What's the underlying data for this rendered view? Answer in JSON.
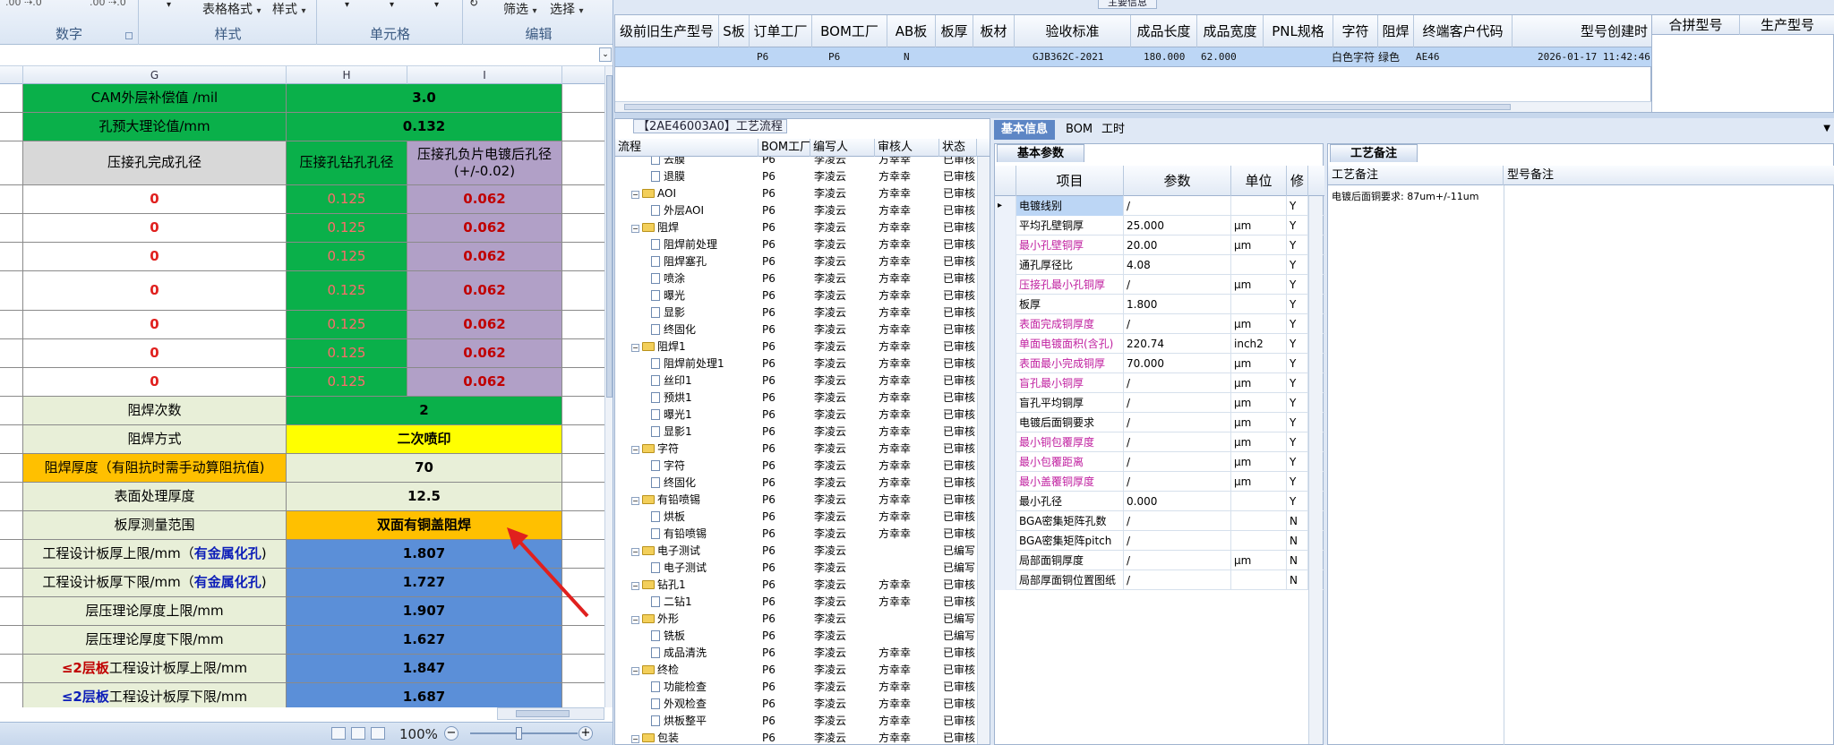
{
  "excel": {
    "ribbon": {
      "number_group": "数字",
      "styles_group": "样式",
      "cells_group": "单元格",
      "editing_group": "编辑",
      "table_format": "表格格式",
      "style": "样式",
      "filter": "筛选",
      "select": "选择"
    },
    "columns": [
      "G",
      "H",
      "I"
    ],
    "rows": [
      {
        "g": "CAM外层补偿值 /mil",
        "h": "3.0",
        "i": ""
      },
      {
        "g": "孔预大理论值/mm",
        "h": "0.132",
        "i": ""
      },
      {
        "g": "压接孔完成孔径",
        "h": "压接孔钻孔孔径",
        "i": "压接孔负片电镀后孔径(+/-0.02)"
      },
      {
        "g": "0",
        "h": "0.125",
        "i": "0.062"
      },
      {
        "g": "0",
        "h": "0.125",
        "i": "0.062"
      },
      {
        "g": "0",
        "h": "0.125",
        "i": "0.062"
      },
      {
        "g": "0",
        "h": "0.125",
        "i": "0.062"
      },
      {
        "g": "0",
        "h": "0.125",
        "i": "0.062"
      },
      {
        "g": "0",
        "h": "0.125",
        "i": "0.062"
      },
      {
        "g": "0",
        "h": "0.125",
        "i": "0.062"
      },
      {
        "g": "阻焊次数",
        "h": "2",
        "i": ""
      },
      {
        "g": "阻焊方式",
        "h": "二次喷印",
        "i": ""
      },
      {
        "g": "阻焊厚度（有阻抗时需手动算阻抗值)",
        "h": "70",
        "i": ""
      },
      {
        "g": "表面处理厚度",
        "h": "12.5",
        "i": ""
      },
      {
        "g": "板厚测量范围",
        "h": "双面有铜盖阻焊",
        "i": ""
      },
      {
        "g_pre": "工程设计板厚上限/mm（",
        "g_em": "有金属化孔",
        "g_post": ")",
        "h": "1.807"
      },
      {
        "g_pre": "工程设计板厚下限/mm（",
        "g_em": "有金属化孔",
        "g_post": ")",
        "h": "1.727"
      },
      {
        "g": "层压理论厚度上限/mm",
        "h": "1.907",
        "i": ""
      },
      {
        "g": "层压理论厚度下限/mm",
        "h": "1.627",
        "i": ""
      },
      {
        "g_red": "≤2层板",
        "g_post": "工程设计板厚上限/mm",
        "h": "1.847"
      },
      {
        "g_red": "≤2层板",
        "g_post": "工程设计板厚下限/mm",
        "h": "1.687"
      }
    ],
    "zoom": "100%"
  },
  "erp": {
    "main_header": "主要信息",
    "top_headers": [
      "级前旧生产型号",
      "S板",
      "订单工厂",
      "BOM工厂",
      "AB板",
      "板厚",
      "板材",
      "验收标准",
      "成品长度",
      "成品宽度",
      "PNL规格",
      "字符",
      "阻焊",
      "终端客户代码",
      "型号创建时"
    ],
    "top_row": {
      "order_factory": "P6",
      "bom_factory": "P6",
      "ab": "N",
      "standard": "GJB362C-2021",
      "length": "180.000",
      "width": "62.000",
      "char": "白色字符",
      "mask": "绿色",
      "customer": "AE46",
      "created": "2026-01-17 11:42:46"
    },
    "combo_headers": [
      "合拼型号",
      "生产型号"
    ],
    "process": {
      "title": "【2AE46003A0】工艺流程",
      "headers": [
        "流程",
        "BOM工厂",
        "编写人",
        "审核人",
        "状态"
      ],
      "rows": [
        {
          "name": "去膜",
          "lvl": 2,
          "f": "P6",
          "w": "李凌云",
          "r": "方幸幸",
          "s": "已审核"
        },
        {
          "name": "退膜",
          "lvl": 2,
          "f": "P6",
          "w": "李凌云",
          "r": "方幸幸",
          "s": "已审核"
        },
        {
          "name": "AOI",
          "lvl": 1,
          "f": "P6",
          "w": "李凌云",
          "r": "方幸幸",
          "s": "已审核"
        },
        {
          "name": "外层AOI",
          "lvl": 2,
          "f": "P6",
          "w": "李凌云",
          "r": "方幸幸",
          "s": "已审核"
        },
        {
          "name": "阻焊",
          "lvl": 1,
          "f": "P6",
          "w": "李凌云",
          "r": "方幸幸",
          "s": "已审核"
        },
        {
          "name": "阻焊前处理",
          "lvl": 2,
          "f": "P6",
          "w": "李凌云",
          "r": "方幸幸",
          "s": "已审核"
        },
        {
          "name": "阻焊塞孔",
          "lvl": 2,
          "f": "P6",
          "w": "李凌云",
          "r": "方幸幸",
          "s": "已审核"
        },
        {
          "name": "喷涂",
          "lvl": 2,
          "f": "P6",
          "w": "李凌云",
          "r": "方幸幸",
          "s": "已审核"
        },
        {
          "name": "曝光",
          "lvl": 2,
          "f": "P6",
          "w": "李凌云",
          "r": "方幸幸",
          "s": "已审核"
        },
        {
          "name": "显影",
          "lvl": 2,
          "f": "P6",
          "w": "李凌云",
          "r": "方幸幸",
          "s": "已审核"
        },
        {
          "name": "终固化",
          "lvl": 2,
          "f": "P6",
          "w": "李凌云",
          "r": "方幸幸",
          "s": "已审核"
        },
        {
          "name": "阻焊1",
          "lvl": 1,
          "f": "P6",
          "w": "李凌云",
          "r": "方幸幸",
          "s": "已审核"
        },
        {
          "name": "阻焊前处理1",
          "lvl": 2,
          "f": "P6",
          "w": "李凌云",
          "r": "方幸幸",
          "s": "已审核"
        },
        {
          "name": "丝印1",
          "lvl": 2,
          "f": "P6",
          "w": "李凌云",
          "r": "方幸幸",
          "s": "已审核"
        },
        {
          "name": "预烘1",
          "lvl": 2,
          "f": "P6",
          "w": "李凌云",
          "r": "方幸幸",
          "s": "已审核"
        },
        {
          "name": "曝光1",
          "lvl": 2,
          "f": "P6",
          "w": "李凌云",
          "r": "方幸幸",
          "s": "已审核"
        },
        {
          "name": "显影1",
          "lvl": 2,
          "f": "P6",
          "w": "李凌云",
          "r": "方幸幸",
          "s": "已审核"
        },
        {
          "name": "字符",
          "lvl": 1,
          "f": "P6",
          "w": "李凌云",
          "r": "方幸幸",
          "s": "已审核"
        },
        {
          "name": "字符",
          "lvl": 2,
          "f": "P6",
          "w": "李凌云",
          "r": "方幸幸",
          "s": "已审核"
        },
        {
          "name": "终固化",
          "lvl": 2,
          "f": "P6",
          "w": "李凌云",
          "r": "方幸幸",
          "s": "已审核"
        },
        {
          "name": "有铅喷锡",
          "lvl": 1,
          "f": "P6",
          "w": "李凌云",
          "r": "方幸幸",
          "s": "已审核"
        },
        {
          "name": "烘板",
          "lvl": 2,
          "f": "P6",
          "w": "李凌云",
          "r": "方幸幸",
          "s": "已审核"
        },
        {
          "name": "有铅喷锡",
          "lvl": 2,
          "f": "P6",
          "w": "李凌云",
          "r": "方幸幸",
          "s": "已审核"
        },
        {
          "name": "电子测试",
          "lvl": 1,
          "f": "P6",
          "w": "李凌云",
          "r": "",
          "s": "已编写"
        },
        {
          "name": "电子测试",
          "lvl": 2,
          "f": "P6",
          "w": "李凌云",
          "r": "",
          "s": "已编写"
        },
        {
          "name": "钻孔1",
          "lvl": 1,
          "f": "P6",
          "w": "李凌云",
          "r": "方幸幸",
          "s": "已审核"
        },
        {
          "name": "二钻1",
          "lvl": 2,
          "f": "P6",
          "w": "李凌云",
          "r": "方幸幸",
          "s": "已审核"
        },
        {
          "name": "外形",
          "lvl": 1,
          "f": "P6",
          "w": "李凌云",
          "r": "",
          "s": "已编写"
        },
        {
          "name": "铣板",
          "lvl": 2,
          "f": "P6",
          "w": "李凌云",
          "r": "",
          "s": "已编写"
        },
        {
          "name": "成品清洗",
          "lvl": 2,
          "f": "P6",
          "w": "李凌云",
          "r": "方幸幸",
          "s": "已审核"
        },
        {
          "name": "终检",
          "lvl": 1,
          "f": "P6",
          "w": "李凌云",
          "r": "方幸幸",
          "s": "已审核"
        },
        {
          "name": "功能检查",
          "lvl": 2,
          "f": "P6",
          "w": "李凌云",
          "r": "方幸幸",
          "s": "已审核"
        },
        {
          "name": "外观检查",
          "lvl": 2,
          "f": "P6",
          "w": "李凌云",
          "r": "方幸幸",
          "s": "已审核"
        },
        {
          "name": "烘板整平",
          "lvl": 2,
          "f": "P6",
          "w": "李凌云",
          "r": "方幸幸",
          "s": "已审核"
        },
        {
          "name": "包装",
          "lvl": 1,
          "f": "P6",
          "w": "李凌云",
          "r": "方幸幸",
          "s": "已审核"
        }
      ]
    },
    "basic": {
      "tabs": [
        "基本信息",
        "BOM",
        "工时"
      ],
      "section": "基本参数",
      "headers": [
        "项目",
        "参数",
        "单位",
        "修改"
      ],
      "rows": [
        {
          "item": "电镀线别",
          "param": "/",
          "unit": "",
          "m": "Y",
          "mag": false
        },
        {
          "item": "平均孔壁铜厚",
          "param": "25.000",
          "unit": "μm",
          "m": "Y",
          "mag": false
        },
        {
          "item": "最小孔壁铜厚",
          "param": "20.00",
          "unit": "μm",
          "m": "Y",
          "mag": true
        },
        {
          "item": "通孔厚径比",
          "param": "4.08",
          "unit": "",
          "m": "Y",
          "mag": false
        },
        {
          "item": "压接孔最小孔铜厚",
          "param": "/",
          "unit": "μm",
          "m": "Y",
          "mag": true
        },
        {
          "item": "板厚",
          "param": "1.800",
          "unit": "",
          "m": "Y",
          "mag": false
        },
        {
          "item": "表面完成铜厚度",
          "param": "/",
          "unit": "μm",
          "m": "Y",
          "mag": true
        },
        {
          "item": "单面电镀面积(含孔)",
          "param": "220.74",
          "unit": "inch2",
          "m": "Y",
          "mag": true
        },
        {
          "item": "表面最小完成铜厚",
          "param": "70.000",
          "unit": "μm",
          "m": "Y",
          "mag": true
        },
        {
          "item": "盲孔最小铜厚",
          "param": "/",
          "unit": "μm",
          "m": "Y",
          "mag": true
        },
        {
          "item": "盲孔平均铜厚",
          "param": "/",
          "unit": "μm",
          "m": "Y",
          "mag": false
        },
        {
          "item": "电镀后面铜要求",
          "param": "/",
          "unit": "μm",
          "m": "Y",
          "mag": false
        },
        {
          "item": "最小铜包覆厚度",
          "param": "/",
          "unit": "μm",
          "m": "Y",
          "mag": true
        },
        {
          "item": "最小包覆距离",
          "param": "/",
          "unit": "μm",
          "m": "Y",
          "mag": true
        },
        {
          "item": "最小盖覆铜厚度",
          "param": "/",
          "unit": "μm",
          "m": "Y",
          "mag": true
        },
        {
          "item": "最小孔径",
          "param": "0.000",
          "unit": "",
          "m": "Y",
          "mag": false
        },
        {
          "item": "BGA密集矩阵孔数",
          "param": "/",
          "unit": "",
          "m": "N",
          "mag": false
        },
        {
          "item": "BGA密集矩阵pitch",
          "param": "/",
          "unit": "",
          "m": "N",
          "mag": false
        },
        {
          "item": "局部面铜厚度",
          "param": "/",
          "unit": "μm",
          "m": "N",
          "mag": false
        },
        {
          "item": "局部厚面铜位置图纸",
          "param": "/",
          "unit": "",
          "m": "N",
          "mag": false
        }
      ]
    },
    "notes": {
      "section": "工艺备注",
      "headers": [
        "工艺备注",
        "型号备注"
      ],
      "text": "电镀后面铜要求: 87um+/-11um"
    }
  }
}
